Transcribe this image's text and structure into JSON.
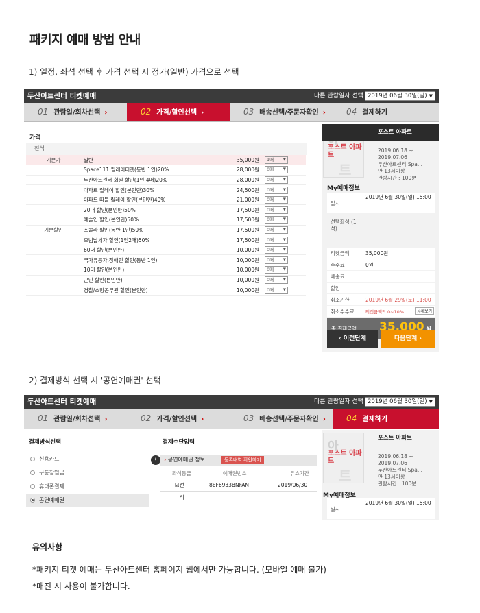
{
  "title": "패키지 예매 방법 안내",
  "step1_text": "1) 일정, 좌석 선택 후 가격 선택 시 정가(일반) 가격으로 선택",
  "step2_text": "2) 결제방식 선택 시 '공연예매권' 선택",
  "app": {
    "brand": "두산아트센터 티켓예매",
    "date_label": "다른 관람일자 선택",
    "date_value": "2019년 06월 30일(일)",
    "date_value2": "2019년 06월 30일(일)"
  },
  "steps": [
    {
      "num": "01",
      "label": "관람일/회차선택"
    },
    {
      "num": "02",
      "label": "가격/할인선택"
    },
    {
      "num": "03",
      "label": "배송선택/주문자확인"
    },
    {
      "num": "04",
      "label": "결제하기"
    }
  ],
  "price": {
    "heading": "가격",
    "sub": "전석",
    "rows": [
      {
        "cat": "기본가",
        "name": "일반",
        "price": "35,000원",
        "qty": "1매"
      },
      {
        "cat": "",
        "name": "Space111 릴레이티켓(동반 1인)20%",
        "price": "28,000원",
        "qty": "0매"
      },
      {
        "cat": "",
        "name": "두산아트센터 회원 할인(1인 4매)20%",
        "price": "28,000원",
        "qty": "0매"
      },
      {
        "cat": "",
        "name": "아파트 릴레이 할인(본인만)30%",
        "price": "24,500원",
        "qty": "0매"
      },
      {
        "cat": "",
        "name": "아파트 따블 릴레이 할인(본인만)40%",
        "price": "21,000원",
        "qty": "0매"
      },
      {
        "cat": "",
        "name": "20대 할인(본인만)50%",
        "price": "17,500원",
        "qty": "0매"
      },
      {
        "cat": "",
        "name": "예술인 할인(본인만)50%",
        "price": "17,500원",
        "qty": "0매"
      },
      {
        "cat": "기본할인",
        "name": "스콜라 할인(동반 1인)50%",
        "price": "17,500원",
        "qty": "0매"
      },
      {
        "cat": "",
        "name": "모범납세자 할인(1인2매)50%",
        "price": "17,500원",
        "qty": "0매"
      },
      {
        "cat": "",
        "name": "60대 할인(본인만)",
        "price": "10,000원",
        "qty": "0매"
      },
      {
        "cat": "",
        "name": "국가유공자,장애인 할인(동반 1인)",
        "price": "10,000원",
        "qty": "0매"
      },
      {
        "cat": "",
        "name": "10대 할인(본인만)",
        "price": "10,000원",
        "qty": "0매"
      },
      {
        "cat": "",
        "name": "군인 할인(본인만)",
        "price": "10,000원",
        "qty": "0매"
      },
      {
        "cat": "",
        "name": "경찰/소방공무원 할인(본인만)",
        "price": "10,000원",
        "qty": "0매"
      }
    ]
  },
  "sidebar": {
    "show_title": "포스트 아파트",
    "poster_line1": "아",
    "poster_line2": "포스트 아파트",
    "poster_line3": "트",
    "info1": "2019.06.18 ~",
    "info2": "2019.07.06",
    "info3": "두산아트센터 Spa...",
    "info4": "만 13세이상",
    "info5": "관람시간 : 100분",
    "my_heading": "My예매정보",
    "kv": [
      {
        "k": "일시",
        "v": "2019년 6월 30일(일) 15:00"
      },
      {
        "k": "선택좌석 (1석)",
        "v": ""
      },
      {
        "k": "티켓금액",
        "v": "35,000원"
      },
      {
        "k": "수수료",
        "v": "0원"
      },
      {
        "k": "배송료",
        "v": ""
      },
      {
        "k": "할인",
        "v": ""
      },
      {
        "k": "취소기한",
        "v": "2019년 6월 29일(토) 11:00"
      },
      {
        "k": "취소수수료",
        "v": "티켓금액의 0~10%"
      }
    ],
    "detail_btn": "상세보기",
    "pay_label": "총 결제금액",
    "pay_value": "35,000",
    "pay_unit": "원",
    "prev_btn": "이전단계",
    "next_btn": "다음단계"
  },
  "payment": {
    "left_heading": "결제방식선택",
    "options": [
      "신용카드",
      "무통장입금",
      "휴대폰결제",
      "공연예매권"
    ],
    "mid_heading": "결제수단입력",
    "voucher_label": "공연예매권 정보",
    "voucher_btn": "등록내역 확인하기",
    "cols": [
      "좌석등급",
      "예매권번호",
      "유효기간"
    ],
    "row": {
      "grade": "전석",
      "number": "8EF6933BNFAN",
      "expiry": "2019/06/30"
    }
  },
  "notice": {
    "heading": "유의사항",
    "line1": "*패키지 티켓 예매는 두산아트센터 홈페이지 웹에서만 가능합니다. (모바일 예매 불가)",
    "line2": "*매진 시 사용이 불가합니다."
  }
}
